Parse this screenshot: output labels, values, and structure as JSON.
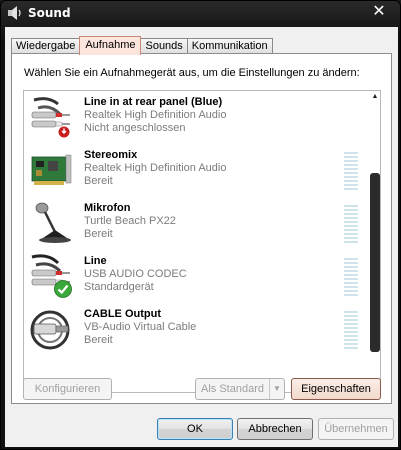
{
  "window": {
    "title": "Sound",
    "close_glyph": "✕"
  },
  "tabs": [
    {
      "label": "Wiedergabe",
      "active": false
    },
    {
      "label": "Aufnahme",
      "active": true
    },
    {
      "label": "Sounds",
      "active": false
    },
    {
      "label": "Kommunikation",
      "active": false
    }
  ],
  "instruction": "Wählen Sie ein Aufnahmegerät aus, um die Einstellungen zu ändern:",
  "devices": [
    {
      "name": "Line in at rear panel (Blue)",
      "driver": "Realtek High Definition Audio",
      "status": "Nicht angeschlossen",
      "icon": "rca-cable-icon",
      "badge": "unplugged-badge-icon",
      "meter": false
    },
    {
      "name": "Stereomix",
      "driver": "Realtek High Definition Audio",
      "status": "Bereit",
      "icon": "sound-card-icon",
      "meter": true
    },
    {
      "name": "Mikrofon",
      "driver": "Turtle Beach PX22",
      "status": "Bereit",
      "icon": "microphone-icon",
      "meter": true
    },
    {
      "name": "Line",
      "driver": "USB AUDIO  CODEC",
      "status": "Standardgerät",
      "icon": "rca-cable-icon",
      "badge": "default-check-badge-icon",
      "meter": true
    },
    {
      "name": "CABLE Output",
      "driver": "VB-Audio Virtual Cable",
      "status": "Bereit",
      "icon": "virtual-cable-icon",
      "meter": true
    }
  ],
  "buttons": {
    "configure": "Konfigurieren",
    "set_default": "Als Standard",
    "properties": "Eigenschaften",
    "ok": "OK",
    "cancel": "Abbrechen",
    "apply": "Übernehmen"
  },
  "colors": {
    "active_tab": "#fce5dd",
    "meter_inactive": "#cfe3ea",
    "check_green": "#3aa83a",
    "unplugged_red": "#c81e1e"
  }
}
